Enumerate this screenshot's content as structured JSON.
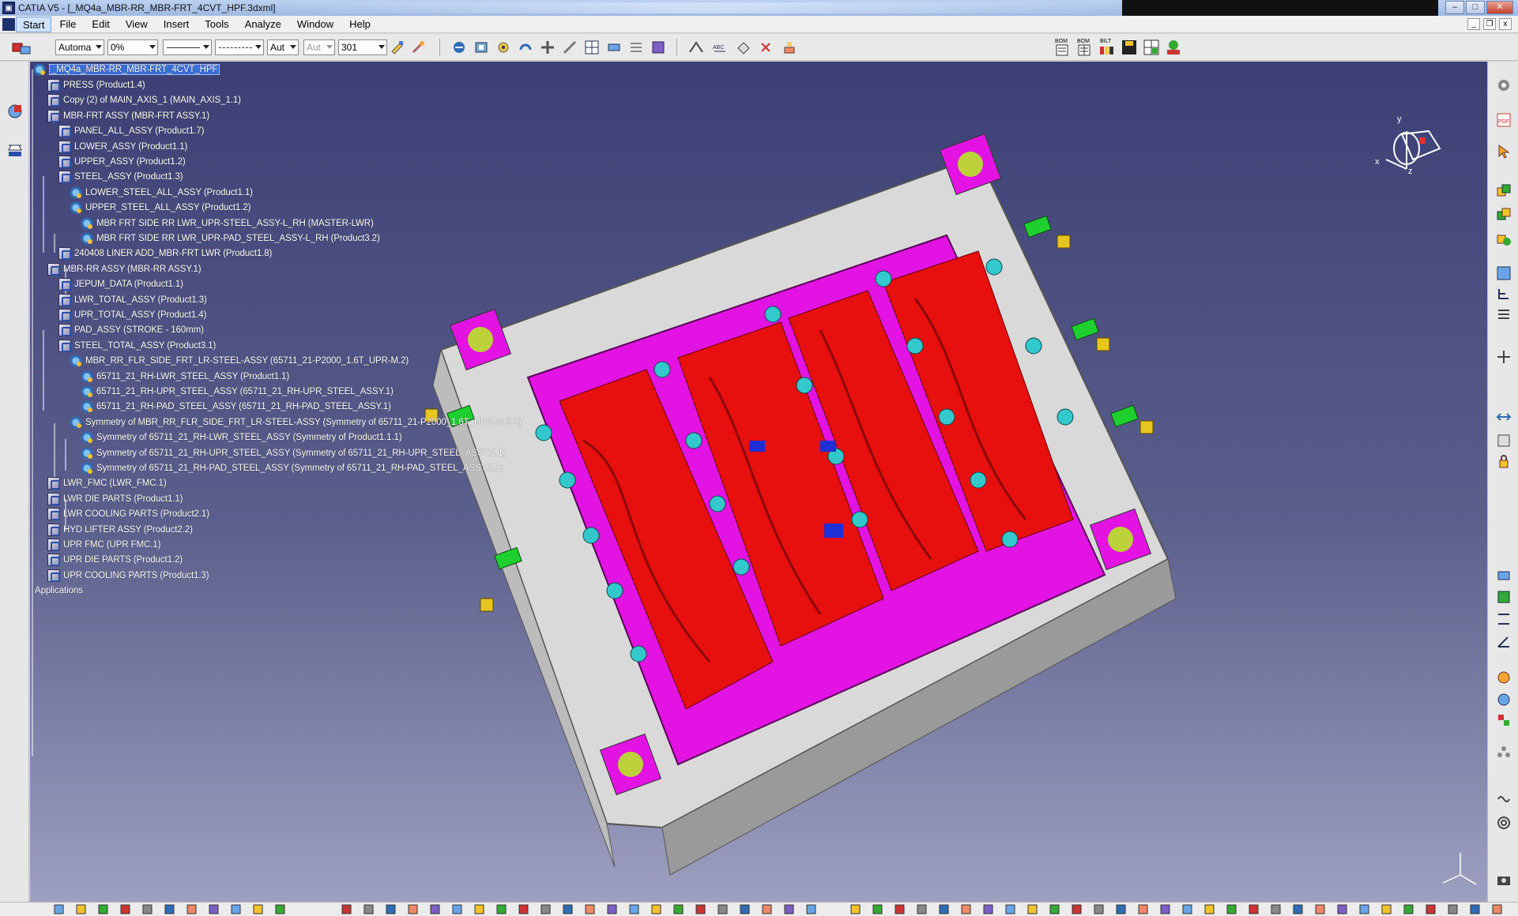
{
  "window": {
    "title": "CATIA V5 - [_MQ4a_MBR-RR_MBR-FRT_4CVT_HPF.3dxml]"
  },
  "menu": {
    "items": [
      "Start",
      "File",
      "Edit",
      "View",
      "Insert",
      "Tools",
      "Analyze",
      "Window",
      "Help"
    ]
  },
  "toolbar": {
    "combo_auto": "Automa",
    "combo_percent": "0%",
    "combo_aut": "Aut",
    "combo_aut_disabled": "Aut",
    "combo_301": "301",
    "bom_labels": [
      "BOM",
      "BOM",
      "BILT"
    ]
  },
  "tree": {
    "root": "_MQ4a_MBR-RR_MBR-FRT_4CVT_HPF",
    "nodes": [
      {
        "label": "PRESS (Product1.4)",
        "level": 1
      },
      {
        "label": "Copy (2) of MAIN_AXIS_1 (MAIN_AXIS_1.1)",
        "level": 1
      },
      {
        "label": "MBR-FRT ASSY (MBR-FRT ASSY.1)",
        "level": 1
      },
      {
        "label": "PANEL_ALL_ASSY (Product1.7)",
        "level": 2
      },
      {
        "label": "LOWER_ASSY (Product1.1)",
        "level": 2
      },
      {
        "label": "UPPER_ASSY (Product1.2)",
        "level": 2
      },
      {
        "label": "STEEL_ASSY (Product1.3)",
        "level": 2
      },
      {
        "label": "LOWER_STEEL_ALL_ASSY (Product1.1)",
        "level": 3
      },
      {
        "label": "UPPER_STEEL_ALL_ASSY (Product1.2)",
        "level": 3
      },
      {
        "label": "MBR FRT SIDE RR LWR_UPR-STEEL_ASSY-L_RH (MASTER-LWR)",
        "level": 4
      },
      {
        "label": "MBR FRT SIDE RR LWR_UPR-PAD_STEEL_ASSY-L_RH (Product3.2)",
        "level": 4
      },
      {
        "label": "240408 LINER ADD_MBR-FRT LWR (Product1.8)",
        "level": 2
      },
      {
        "label": "MBR-RR ASSY (MBR-RR ASSY.1)",
        "level": 1
      },
      {
        "label": "JEPUM_DATA (Product1.1)",
        "level": 2
      },
      {
        "label": "LWR_TOTAL_ASSY (Product1.3)",
        "level": 2
      },
      {
        "label": "UPR_TOTAL_ASSY (Product1.4)",
        "level": 2
      },
      {
        "label": "PAD_ASSY (STROKE - 160mm)",
        "level": 2
      },
      {
        "label": "STEEL_TOTAL_ASSY (Product3.1)",
        "level": 2
      },
      {
        "label": "MBR_RR_FLR_SIDE_FRT_LR-STEEL-ASSY (65711_21-P2000_1.6T_UPR-M.2)",
        "level": 3
      },
      {
        "label": "65711_21_RH-LWR_STEEL_ASSY (Product1.1)",
        "level": 4
      },
      {
        "label": "65711_21_RH-UPR_STEEL_ASSY (65711_21_RH-UPR_STEEL_ASSY.1)",
        "level": 4
      },
      {
        "label": "65711_21_RH-PAD_STEEL_ASSY (65711_21_RH-PAD_STEEL_ASSY.1)",
        "level": 4
      },
      {
        "label": "Symmetry of MBR_RR_FLR_SIDE_FRT_LR-STEEL-ASSY (Symmetry of 65711_21-P2000_1.6T_UPR-M.2.1)",
        "level": 3
      },
      {
        "label": "Symmetry of 65711_21_RH-LWR_STEEL_ASSY (Symmetry of Product1.1.1)",
        "level": 4
      },
      {
        "label": "Symmetry of 65711_21_RH-UPR_STEEL_ASSY (Symmetry of 65711_21_RH-UPR_STEEL_ASSY.1.1)",
        "level": 4
      },
      {
        "label": "Symmetry of 65711_21_RH-PAD_STEEL_ASSY (Symmetry of 65711_21_RH-PAD_STEEL_ASSY.1.1)",
        "level": 4
      },
      {
        "label": "LWR_FMC (LWR_FMC.1)",
        "level": 1
      },
      {
        "label": "LWR DIE PARTS (Product1.1)",
        "level": 1
      },
      {
        "label": "LWR COOLING PARTS (Product2.1)",
        "level": 1
      },
      {
        "label": "HYD LIFTER ASSY (Product2.2)",
        "level": 1
      },
      {
        "label": "UPR FMC (UPR FMC.1)",
        "level": 1
      },
      {
        "label": "UPR DIE PARTS (Product1.2)",
        "level": 1
      },
      {
        "label": "UPR COOLING PARTS (Product1.3)",
        "level": 1
      }
    ],
    "applications": "Applications"
  },
  "compass": {
    "x_label": "x",
    "y_label": "y",
    "z_label": "z"
  },
  "colors": {
    "viewport_top": "#3c3f74",
    "viewport_bottom": "#9da0bf",
    "steel": "#e80f0f",
    "plate": "#e313e3",
    "guide": "#33c8cc"
  }
}
